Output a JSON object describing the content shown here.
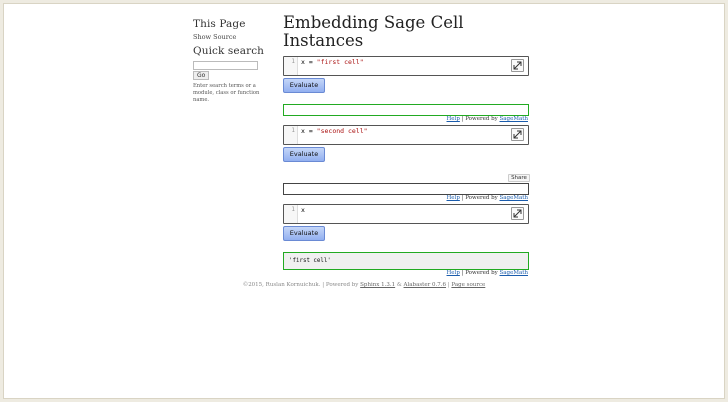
{
  "sidebar": {
    "this_page_heading": "This Page",
    "show_source_link": "Show Source",
    "quick_search_heading": "Quick search",
    "search_placeholder": "",
    "go_button": "Go",
    "search_note": "Enter search terms or a module, class or function name."
  },
  "main": {
    "title_line1": "Embedding Sage Cell",
    "title_line2": "Instances"
  },
  "cells": [
    {
      "line_number": "1",
      "code_var": "x",
      "code_op": " = ",
      "code_str": "\"first cell\"",
      "evaluate_label": "Evaluate",
      "output_text": ""
    },
    {
      "line_number": "1",
      "code_var": "x",
      "code_op": " = ",
      "code_str": "\"second cell\"",
      "evaluate_label": "Evaluate",
      "share_label": "Share",
      "output_text": ""
    },
    {
      "line_number": "1",
      "code_var": "x",
      "code_op": "",
      "code_str": "",
      "evaluate_label": "Evaluate",
      "output_text": "'first cell'"
    }
  ],
  "powered": {
    "help": "Help",
    "separator": " | Powered by ",
    "sagemath": "SageMath"
  },
  "footer": {
    "copyright": "©2015, Ruslan Kornuichuk.",
    "powered_by": " | Powered by ",
    "sphinx": "Sphinx 1.3.1",
    "amp": " & ",
    "alabaster": "Alabaster 0.7.6",
    "sep": " | ",
    "page_source": "Page source"
  },
  "colors": {
    "output_border_active": "#22aa22",
    "evaluate_button": "#92aff0",
    "link": "#1a5cad"
  },
  "icons": {
    "expand": "expand-diagonal-arrow-icon"
  }
}
